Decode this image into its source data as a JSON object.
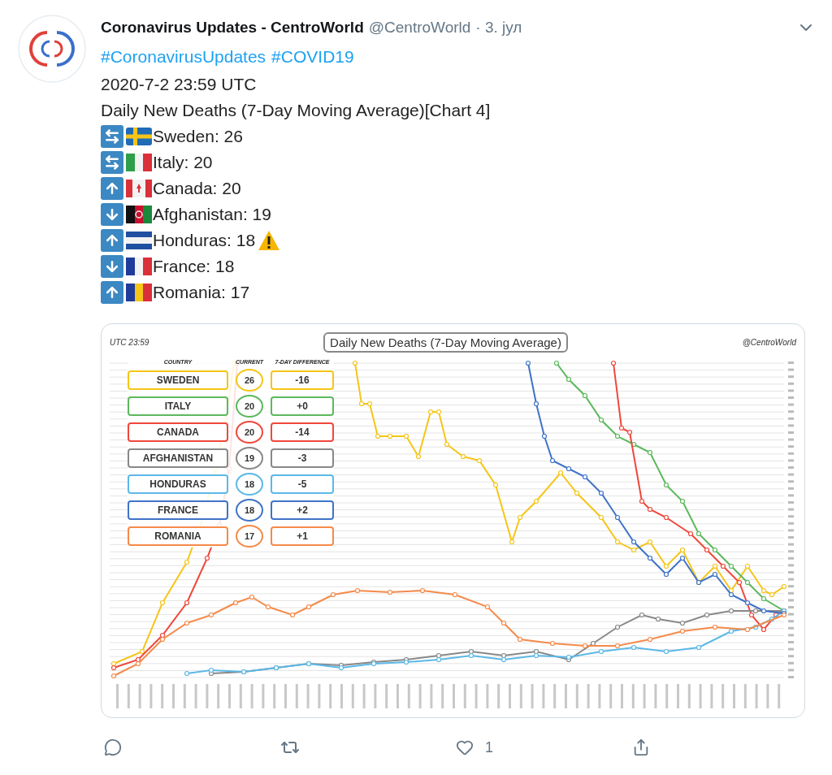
{
  "tweet": {
    "author_name": "Coronavirus Updates - CentroWorld",
    "handle": "@CentroWorld",
    "date": "· 3. јул",
    "hashtags": [
      "#CoronavirusUpdates",
      "#COVID19"
    ],
    "lines": [
      "2020-7-2 23:59 UTC",
      "Daily New Deaths (7-Day Moving Average)[Chart 4]"
    ],
    "entries": [
      {
        "kind": "flat",
        "flag": {
          "kind": "se"
        },
        "text": "Sweden: 26",
        "warning": false
      },
      {
        "kind": "flat",
        "flag": {
          "kind": "it"
        },
        "text": "Italy: 20",
        "warning": false
      },
      {
        "kind": "up",
        "flag": {
          "kind": "ca"
        },
        "text": "Canada: 20",
        "warning": false
      },
      {
        "kind": "down",
        "flag": {
          "kind": "af"
        },
        "text": "Afghanistan: 19",
        "warning": false
      },
      {
        "kind": "up",
        "flag": {
          "kind": "hn"
        },
        "text": "Honduras: 18",
        "warning": true
      },
      {
        "kind": "down",
        "flag": {
          "kind": "fr"
        },
        "text": "France: 18",
        "warning": false
      },
      {
        "kind": "up",
        "flag": {
          "kind": "ro"
        },
        "text": "Romania: 17",
        "warning": false
      }
    ]
  },
  "chart_image": {
    "time_label": "UTC 23:59",
    "title": "Daily New Deaths (7-Day Moving Average)",
    "credit": "@CentroWorld",
    "headers": [
      "COUNTRY",
      "CURRENT",
      "7-DAY DIFFERENCE"
    ],
    "rows": [
      {
        "country": "SWEDEN",
        "current": "26",
        "difference": "-16",
        "color": "#f5c518"
      },
      {
        "country": "ITALY",
        "current": "20",
        "difference": "+0",
        "color": "#5cb85c"
      },
      {
        "country": "CANADA",
        "current": "20",
        "difference": "-14",
        "color": "#f0473c"
      },
      {
        "country": "AFGHANISTAN",
        "current": "19",
        "difference": "-3",
        "color": "#888888"
      },
      {
        "country": "HONDURAS",
        "current": "18",
        "difference": "-5",
        "color": "#5bb8e8"
      },
      {
        "country": "FRANCE",
        "current": "18",
        "difference": "+2",
        "color": "#3f73c9"
      },
      {
        "country": "ROMANIA",
        "current": "17",
        "difference": "+1",
        "color": "#f58a4a"
      }
    ]
  },
  "actions": [
    {
      "kind": "reply"
    },
    {
      "kind": "retweet"
    },
    {
      "kind": "like",
      "count": "1"
    },
    {
      "kind": "share"
    }
  ]
}
